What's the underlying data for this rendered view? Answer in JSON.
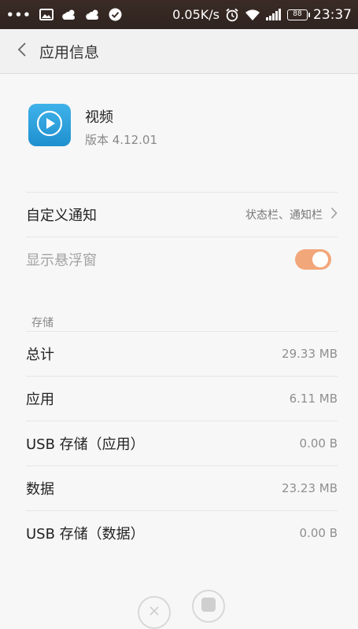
{
  "status_bar": {
    "dots": "•••",
    "speed": "0.05K/s",
    "battery": "88",
    "time": "23:37",
    "icons": [
      "image-icon",
      "cloud-sun-icon",
      "cloud-sun-icon",
      "check-circle-icon",
      "alarm-icon",
      "wifi-icon",
      "signal-icon",
      "battery-icon"
    ]
  },
  "header": {
    "title": "应用信息",
    "back_icon": "chevron-left-icon"
  },
  "app": {
    "name": "视频",
    "version": "版本 4.12.01",
    "icon": "play-icon",
    "icon_color": "#2ea1de"
  },
  "settings": {
    "custom_notification": {
      "label": "自定义通知",
      "value": "状态栏、通知栏"
    },
    "floating_window": {
      "label": "显示悬浮窗",
      "enabled": true,
      "toggle_color": "#f2a77a"
    }
  },
  "storage": {
    "section_label": "存储",
    "items": [
      {
        "label": "总计",
        "value": "29.33 MB"
      },
      {
        "label": "应用",
        "value": "6.11 MB"
      },
      {
        "label": "USB 存储（应用）",
        "value": "0.00 B"
      },
      {
        "label": "数据",
        "value": "23.23 MB"
      },
      {
        "label": "USB 存储（数据）",
        "value": "0.00 B"
      }
    ]
  },
  "bottom_actions": {
    "uninstall_icon": "close-circle-icon",
    "stop_icon": "stop-square-icon"
  }
}
